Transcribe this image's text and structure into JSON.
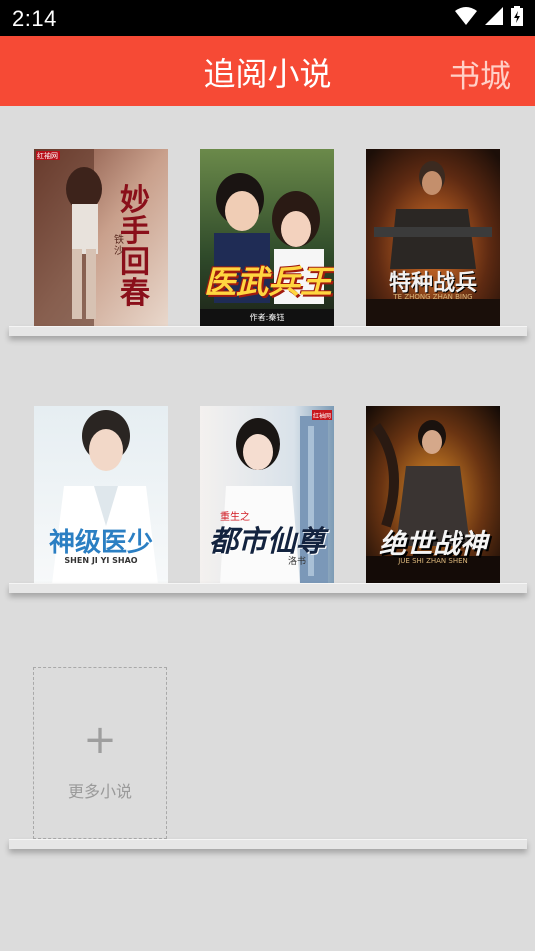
{
  "status": {
    "time": "2:14"
  },
  "header": {
    "title": "追阅小说",
    "action_label": "书城"
  },
  "books": [
    {
      "title": "妙手回春",
      "author": "铁沙",
      "publisher": "红袖网"
    },
    {
      "title": "医武兵王",
      "author": "作者:秦钰"
    },
    {
      "title": "特种战兵",
      "subtitle": "TE ZHONG ZHAN BING"
    },
    {
      "title": "神级医少",
      "subtitle": "SHEN JI YI SHAO"
    },
    {
      "title": "都市仙尊",
      "tag": "重生之",
      "author": "洛书",
      "publisher": "红袖网"
    },
    {
      "title": "绝世战神",
      "subtitle": "JUE SHI ZHAN SHEN"
    }
  ],
  "add_more": {
    "label": "更多小说",
    "plus": "+"
  },
  "colors": {
    "accent": "#f64a35",
    "background": "#dcdcdc"
  }
}
